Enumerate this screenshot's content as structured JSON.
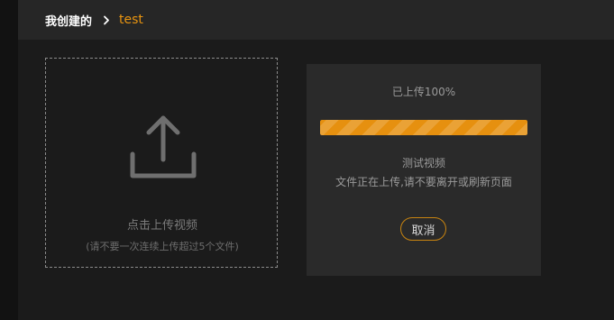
{
  "breadcrumb": {
    "root": "我创建的",
    "separator_icon": "chevron-right-icon",
    "current": "test"
  },
  "dropzone": {
    "icon": "upload-icon",
    "title": "点击上传视频",
    "hint": "(请不要一次连续上传超过5个文件)"
  },
  "upload_status": {
    "progress_label": "已上传100%",
    "progress_fraction": 1.0,
    "file_name": "测试视频",
    "message": "文件正在上传,请不要离开或刷新页面",
    "cancel_label": "取消"
  },
  "colors": {
    "background": "#1b1b1b",
    "header": "#262626",
    "accent": "#e6900f",
    "card": "#2a2a2a"
  }
}
